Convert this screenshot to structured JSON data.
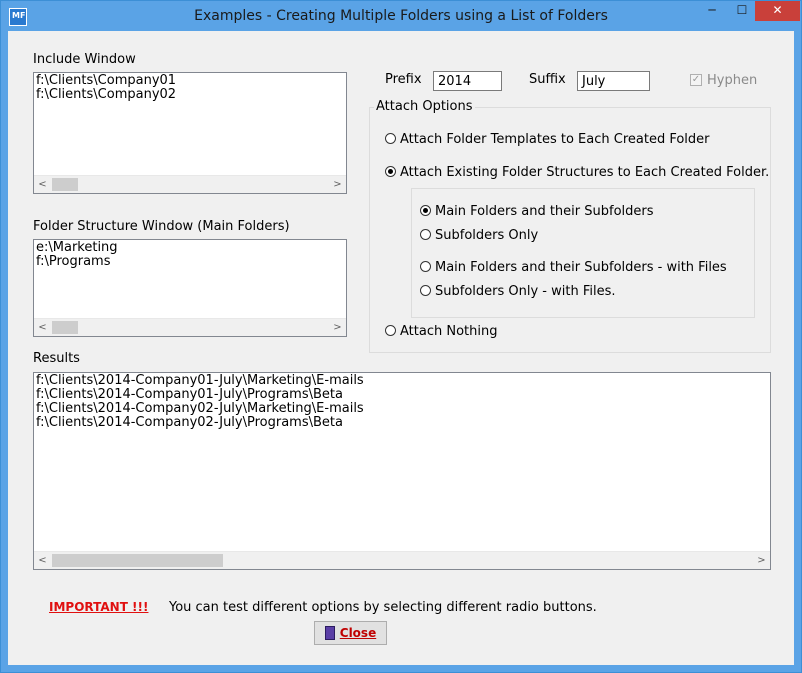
{
  "window": {
    "title": "Examples - Creating Multiple Folders using a List of Folders",
    "min_glyph": "─",
    "max_glyph": "☐",
    "close_glyph": "✕",
    "icon_text": "MF"
  },
  "include": {
    "label": "Include Window",
    "lines": [
      "f:\\Clients\\Company01",
      "f:\\Clients\\Company02"
    ]
  },
  "folder_structure": {
    "label": "Folder Structure Window (Main Folders)",
    "lines": [
      "e:\\Marketing",
      "f:\\Programs"
    ]
  },
  "scroll": {
    "left": "<",
    "right": ">"
  },
  "prefix": {
    "label": "Prefix",
    "value": "2014"
  },
  "suffix": {
    "label": "Suffix",
    "value": "July"
  },
  "hyphen": {
    "label": "Hyphen",
    "checked": true,
    "check_glyph": "✓"
  },
  "attach_options": {
    "title": "Attach Options",
    "templates": "Attach Folder Templates to Each Created Folder",
    "existing": "Attach Existing Folder Structures to Each Created Folder.",
    "nothing": "Attach Nothing",
    "selected": "existing",
    "sub": {
      "main_sub": "Main Folders and their Subfolders",
      "sub_only": "Subfolders Only",
      "main_sub_files": "Main Folders and their Subfolders - with Files",
      "sub_only_files": "Subfolders Only - with Files.",
      "selected": "main_sub"
    }
  },
  "results": {
    "label": "Results",
    "lines": [
      "f:\\Clients\\2014-Company01-July\\Marketing\\E-mails",
      "f:\\Clients\\2014-Company01-July\\Programs\\Beta",
      "f:\\Clients\\2014-Company02-July\\Marketing\\E-mails",
      "f:\\Clients\\2014-Company02-July\\Programs\\Beta"
    ]
  },
  "footer": {
    "important": "IMPORTANT !!!",
    "note": "You can test different options by selecting different radio buttons.",
    "close": "Close"
  }
}
